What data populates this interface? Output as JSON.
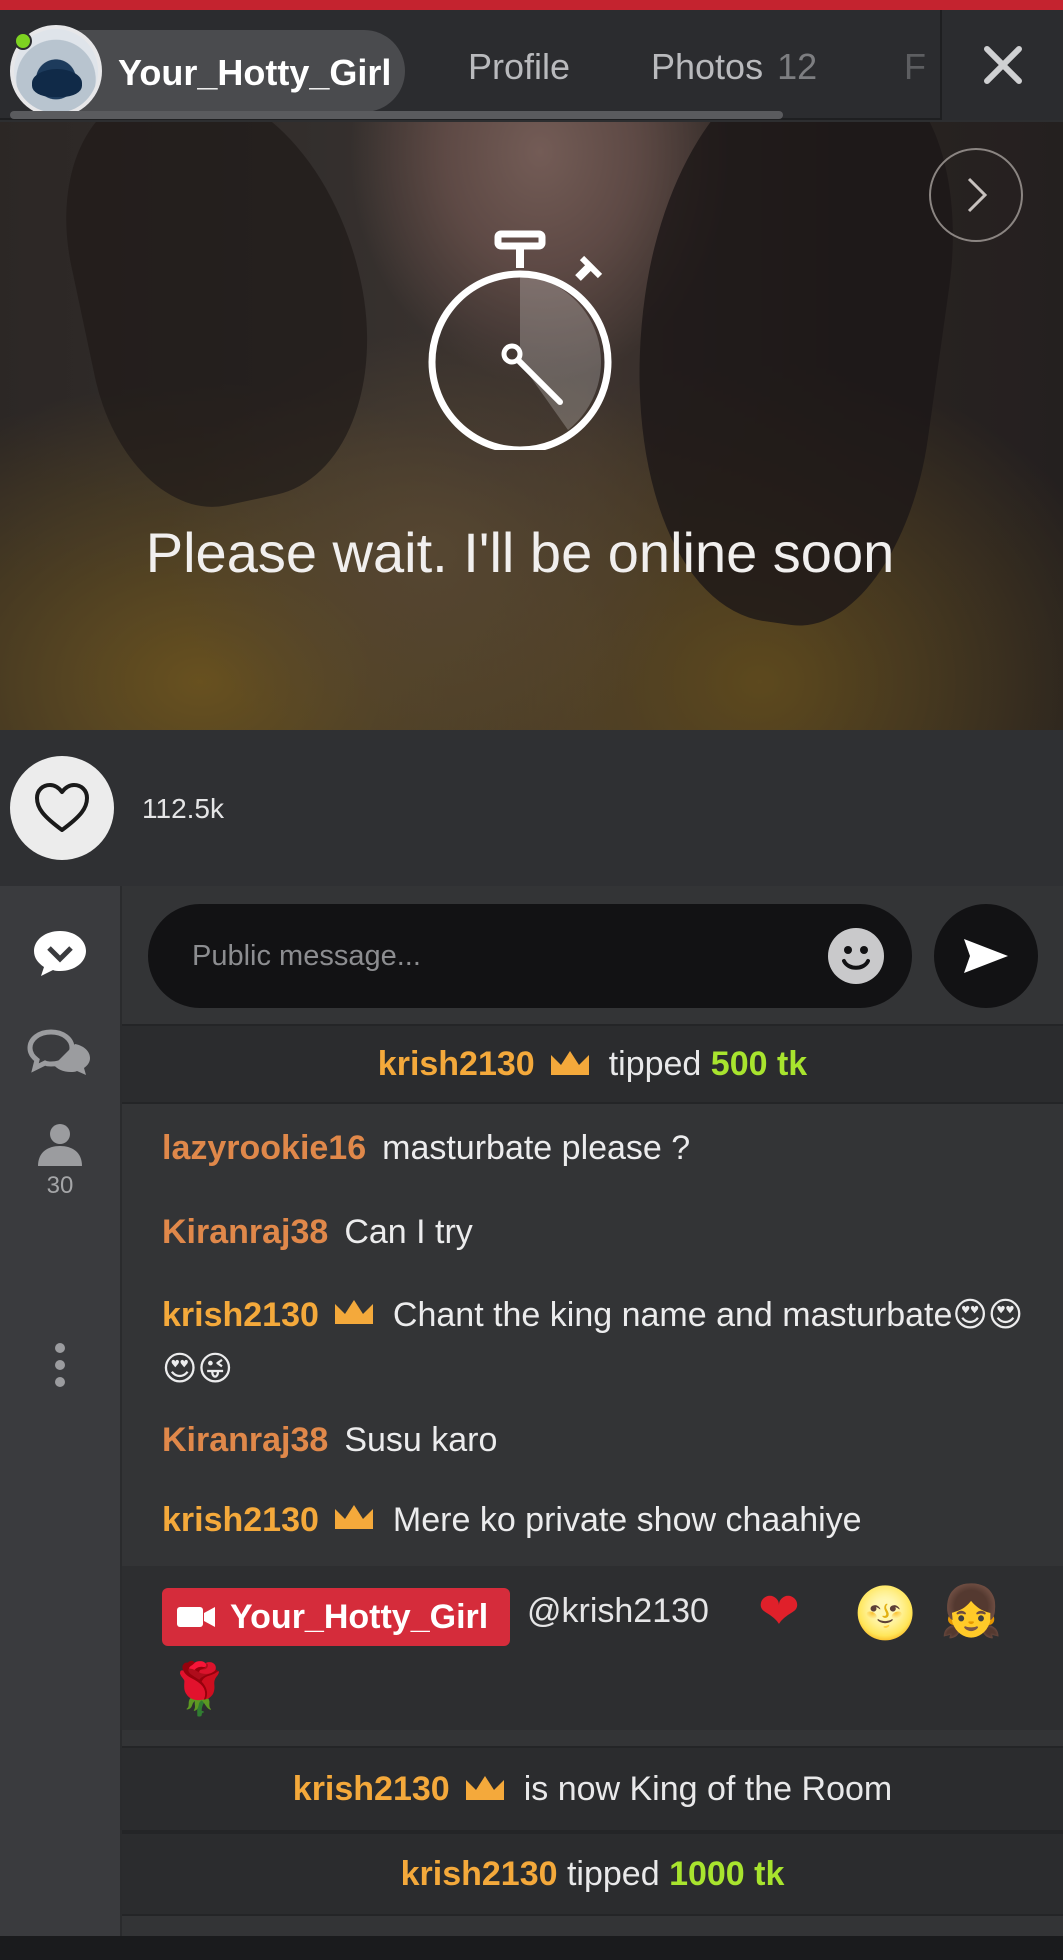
{
  "header": {
    "model_name": "Your_Hotty_Girl",
    "tabs": [
      {
        "label": "Profile"
      },
      {
        "label": "Photos",
        "count": "12"
      },
      {
        "label": "F"
      }
    ],
    "close_icon": "close-icon"
  },
  "video": {
    "status_text": "Please wait. I'll be online soon",
    "status_icon": "stopwatch-icon",
    "next_icon": "chevron-right-icon"
  },
  "likes": {
    "count": "112.5k",
    "icon": "heart-icon"
  },
  "rail": {
    "items": [
      {
        "icon": "chat-bubble-icon"
      },
      {
        "icon": "private-chat-icon"
      },
      {
        "icon": "users-icon",
        "count": "30"
      },
      {
        "icon": "more-vertical-icon"
      }
    ]
  },
  "composer": {
    "placeholder": "Public message...",
    "emoji_icon": "smiley-icon",
    "send_icon": "send-icon"
  },
  "chat": {
    "tip1": {
      "user": "krish2130",
      "verb": "tipped",
      "amount": "500 tk"
    },
    "messages": [
      {
        "user": "lazyrookie16",
        "text": "masturbate please ?"
      },
      {
        "user": "Kiranraj38",
        "text": "Can I try"
      },
      {
        "user": "krish2130",
        "text": "Chant the king name and masturbate😍😍😍😜"
      },
      {
        "user": "Kiranraj38",
        "text": "Susu karo"
      },
      {
        "user": "krish2130",
        "text": "Mere ko private show chaahiye"
      }
    ],
    "model_message": {
      "name": "Your_Hotty_Girl",
      "mention": "@krish2130",
      "emojis": [
        "❤",
        "🌝",
        "👧",
        "🌹"
      ]
    },
    "king_notice": {
      "user": "krish2130",
      "text": "is now King of the Room"
    },
    "tip2": {
      "user": "krish2130",
      "verb": "tipped",
      "amount": "1000 tk"
    }
  },
  "colors": {
    "accent_red": "#d52c3b",
    "gold": "#f4a93b",
    "orange_user": "#e0884a",
    "tip_green": "#a8e42e",
    "online": "#7ed321"
  }
}
